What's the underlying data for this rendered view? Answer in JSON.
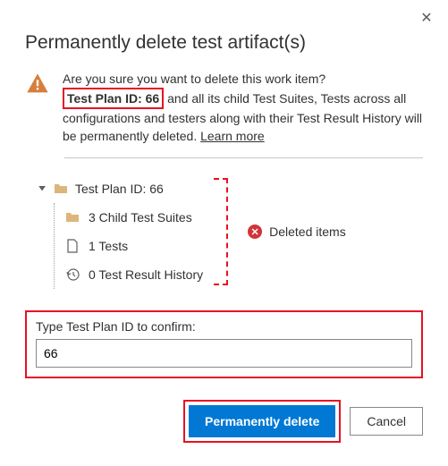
{
  "dialog": {
    "title": "Permanently delete test artifact(s)",
    "close_label": "✕"
  },
  "warning": {
    "text_pre": "Are you sure you want to delete this work item?",
    "highlight": "Test Plan ID: 66",
    "text_post": " and all its child Test Suites, Tests across all configurations and testers along with their Test Result History will be permanently deleted. ",
    "learn_more": "Learn more"
  },
  "tree": {
    "root": "Test Plan ID: 66",
    "children": [
      "3 Child Test Suites",
      "1 Tests",
      "0 Test Result History"
    ]
  },
  "deleted_label": "Deleted items",
  "confirm": {
    "label": "Type Test Plan ID to confirm:",
    "value": "66"
  },
  "buttons": {
    "primary": "Permanently delete",
    "secondary": "Cancel"
  }
}
